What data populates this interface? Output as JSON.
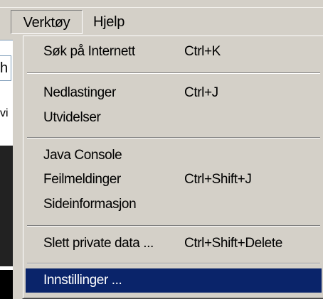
{
  "menubar": {
    "items": [
      {
        "label": "Verktøy",
        "active": true
      },
      {
        "label": "Hjelp",
        "active": false
      }
    ]
  },
  "background": {
    "fragments": [
      "h",
      "vi"
    ]
  },
  "menu": {
    "items": [
      {
        "label": "Søk på Internett",
        "shortcut": "Ctrl+K"
      },
      {
        "label": "Nedlastinger",
        "shortcut": "Ctrl+J"
      },
      {
        "label": "Utvidelser",
        "shortcut": ""
      },
      {
        "label": "Java Console",
        "shortcut": ""
      },
      {
        "label": "Feilmeldinger",
        "shortcut": "Ctrl+Shift+J"
      },
      {
        "label": "Sideinformasjon",
        "shortcut": ""
      },
      {
        "label": "Slett private data ...",
        "shortcut": "Ctrl+Shift+Delete"
      },
      {
        "label": "Innstillinger ...",
        "shortcut": "",
        "selected": true
      }
    ]
  },
  "colors": {
    "menu_background": "#d4d0c8",
    "selection": "#0a246a",
    "selection_text": "#ffffff"
  }
}
